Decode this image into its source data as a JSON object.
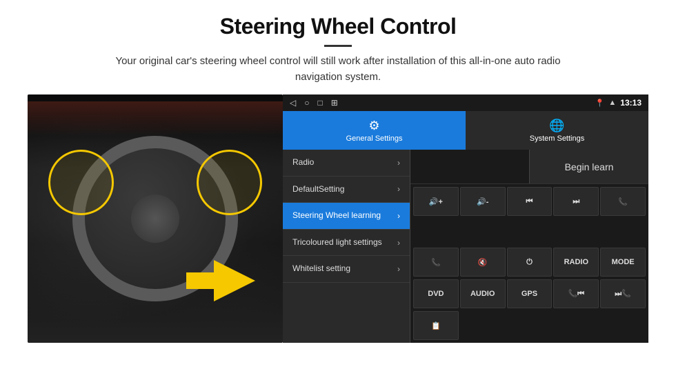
{
  "page": {
    "title": "Steering Wheel Control",
    "subtitle": "Your original car's steering wheel control will still work after installation of this all-in-one auto radio navigation system."
  },
  "android": {
    "status_bar": {
      "time": "13:13",
      "signal_icon": "📶",
      "wifi_icon": "▲",
      "location_icon": "📍"
    },
    "nav": {
      "back": "◁",
      "home": "○",
      "recents": "□",
      "menu": "⊞"
    },
    "tabs": {
      "general": {
        "label": "General Settings",
        "icon": "⚙"
      },
      "system": {
        "label": "System Settings",
        "icon": "🌐"
      }
    },
    "menu": {
      "items": [
        {
          "label": "Radio",
          "active": false
        },
        {
          "label": "DefaultSetting",
          "active": false
        },
        {
          "label": "Steering Wheel learning",
          "active": true
        },
        {
          "label": "Tricoloured light settings",
          "active": false
        },
        {
          "label": "Whitelist setting",
          "active": false
        }
      ]
    },
    "controls": {
      "begin_learn": "Begin learn",
      "buttons_row1": [
        {
          "label": "◀◀",
          "type": "icon"
        },
        {
          "label": "▶▶",
          "type": "icon"
        },
        {
          "label": "📞",
          "type": "icon"
        },
        {
          "label": "🔊+",
          "type": "text"
        },
        {
          "label": "🔊-",
          "type": "text"
        }
      ],
      "buttons_row2": [
        {
          "label": "📞",
          "type": "icon"
        },
        {
          "label": "🔇",
          "type": "icon"
        },
        {
          "label": "⏻",
          "type": "icon"
        },
        {
          "label": "RADIO",
          "type": "text"
        },
        {
          "label": "MODE",
          "type": "text"
        }
      ],
      "buttons_row3": [
        {
          "label": "DVD",
          "type": "text"
        },
        {
          "label": "AUDIO",
          "type": "text"
        },
        {
          "label": "GPS",
          "type": "text"
        },
        {
          "label": "📞◀◀",
          "type": "text"
        },
        {
          "label": "▶▶📞",
          "type": "text"
        }
      ],
      "buttons_row4": [
        {
          "label": "📋",
          "type": "icon"
        }
      ]
    }
  }
}
